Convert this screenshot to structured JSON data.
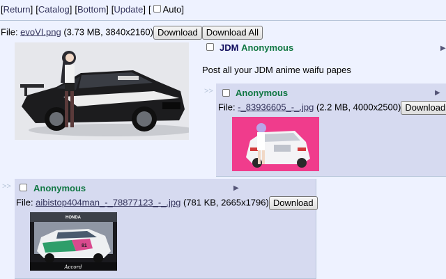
{
  "nav": {
    "open_bracket_1": "[",
    "return_label": "Return",
    "close_bracket_1": "]",
    "open_bracket_2": "[",
    "catalog_label": "Catalog",
    "close_bracket_2": "]",
    "open_bracket_3": "[",
    "bottom_label": "Bottom",
    "close_bracket_3": "]",
    "open_bracket_4": "[",
    "update_label": "Update",
    "close_bracket_4": "]",
    "open_bracket_5": "[",
    "auto_label": "Auto]"
  },
  "op": {
    "file_prefix": "File: ",
    "filename": "evoVI.png",
    "file_meta": " (3.73 MB, 3840x2160)",
    "download_label": "Download",
    "download_all_label": "Download All",
    "subject": "JDM",
    "name": "Anonymous",
    "message": "Post all your JDM anime waifu papes",
    "menu_glyph": "▶"
  },
  "replies": [
    {
      "arrows": ">>",
      "name": "Anonymous",
      "menu_glyph": "▶",
      "file_prefix": "File: ",
      "filename": "-_83936605_-_.jpg",
      "file_meta": " (2.2 MB, 4000x2500)",
      "download_label": "Download"
    },
    {
      "arrows": ">>",
      "name": "Anonymous",
      "menu_glyph": "▶",
      "file_prefix": "File: ",
      "filename": "aibistop404man_-_78877123_-_.jpg",
      "file_meta": " (781 KB, 2665x1796)",
      "download_label": "Download"
    }
  ],
  "colors": {
    "background": "#EEF2FF",
    "reply_background": "#D6DAF0",
    "name_green": "#117743",
    "subject_blue": "#0F0C5D",
    "link": "#34345C",
    "thumb_pink": "#F03C8C"
  },
  "thumb_text": {
    "honda": "HONDA",
    "accord": "Accord",
    "car_number": "81"
  }
}
